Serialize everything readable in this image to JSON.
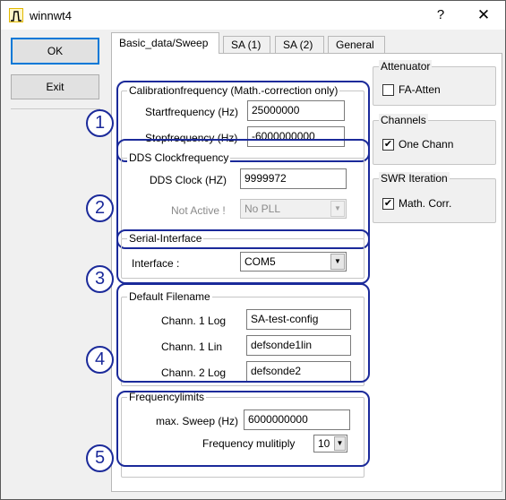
{
  "window": {
    "title": "winnwt4",
    "help": "?",
    "close": "✕"
  },
  "buttons": {
    "ok": "OK",
    "exit": "Exit"
  },
  "tabs": [
    "Basic_data/Sweep",
    "SA (1)",
    "SA (2)",
    "General"
  ],
  "calibration": {
    "title": "Calibrationfrequency (Math.-correction only)",
    "start_label": "Startfrequency (Hz)",
    "start_value": "25000000",
    "stop_label": "Stopfrequency (Hz)",
    "stop_value": "-6000000000"
  },
  "dds": {
    "title": "DDS Clockfrequency",
    "clock_label": "DDS Clock (HZ)",
    "clock_value": "9999972",
    "notactive_label": "Not Active !",
    "pll_value": "No PLL"
  },
  "serial": {
    "title": "Serial-Interface",
    "interface_label": "Interface :",
    "interface_value": "COM5"
  },
  "filename": {
    "title": "Default Filename",
    "c1log_label": "Chann. 1  Log",
    "c1log_value": "SA-test-config",
    "c1lin_label": "Chann. 1  Lin",
    "c1lin_value": "defsonde1lin",
    "c2log_label": "Chann. 2 Log",
    "c2log_value": "defsonde2"
  },
  "freqlimits": {
    "title": "Frequencylimits",
    "max_label": "max. Sweep (Hz)",
    "max_value": "6000000000",
    "mult_label": "Frequency mulitiply",
    "mult_value": "10"
  },
  "attenuator": {
    "title": "Attenuator",
    "label": "FA-Atten",
    "checked": false
  },
  "channels": {
    "title": "Channels",
    "label": "One Chann",
    "checked": true
  },
  "swr": {
    "title": "SWR Iteration",
    "label": "Math. Corr.",
    "checked": true
  },
  "badges": [
    "1",
    "2",
    "3",
    "4",
    "5"
  ],
  "colors": {
    "annotation": "#1b2a9a",
    "focus": "#0078d7"
  }
}
